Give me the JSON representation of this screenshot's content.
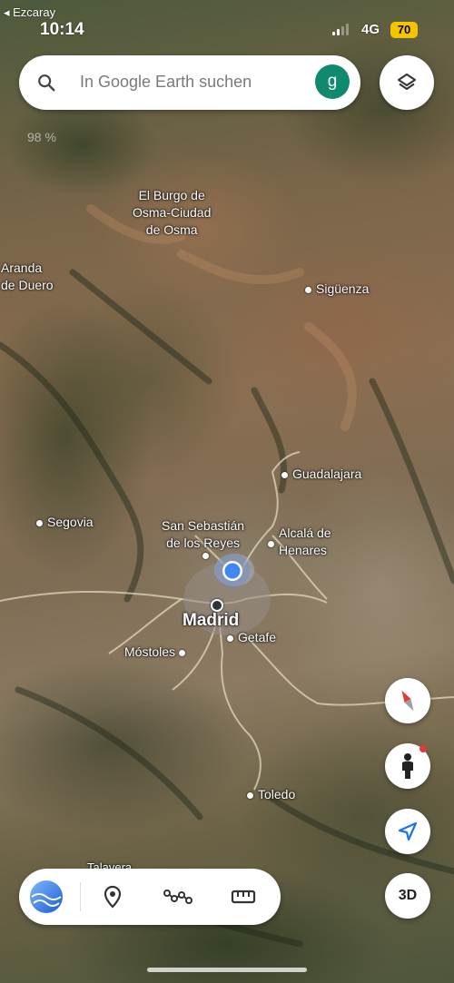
{
  "status_bar": {
    "back_app": "◂ Ezcaray",
    "time": "10:14",
    "network": "4G",
    "battery": "70"
  },
  "search": {
    "placeholder": "In Google Earth suchen",
    "avatar_letter": "g"
  },
  "zoom_readout": "98 %",
  "places": {
    "el_burgo": "El Burgo de\nOsma-Ciudad\nde Osma",
    "aranda": "Aranda\nde Duero",
    "siguenza": "Sigüenza",
    "guadalajara": "Guadalajara",
    "segovia": "Segovia",
    "san_sebastian": "San Sebastián\nde los Reyes",
    "alcala": "Alcalá de\nHenares",
    "madrid": "Madrid",
    "getafe": "Getafe",
    "mostoles": "Móstoles",
    "toledo": "Toledo",
    "talavera": "Talavera"
  },
  "controls": {
    "three_d_label": "3D"
  },
  "toolbar": {
    "items": [
      "voyager",
      "place-marker",
      "path-tool",
      "measure-tool"
    ]
  },
  "colors": {
    "accent_blue": "#4285f4",
    "avatar_green": "#0f8a6e",
    "battery_yellow": "#f4c400",
    "compass_red": "#e53935"
  }
}
